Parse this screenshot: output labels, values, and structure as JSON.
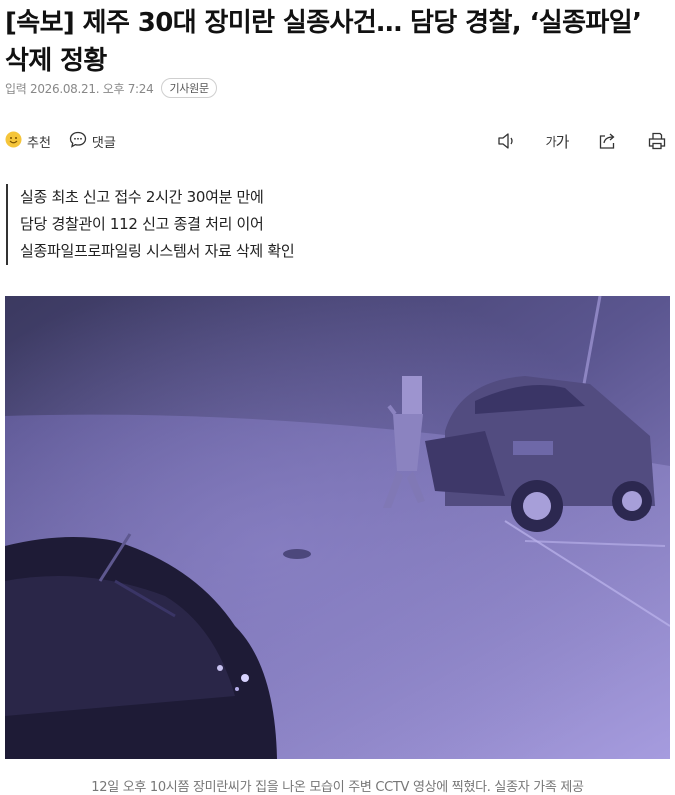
{
  "article": {
    "headline": "[속보] 제주 30대 장미란 실종사건… 담당 경찰, ‘실종파일’ 삭제 정황",
    "meta": {
      "date_text": "입력 2026.08.21. 오후 7:24",
      "original_badge": "기사원문"
    },
    "toolbar": {
      "recommend_label": "추천",
      "comment_label": "댓글",
      "font_size_small": "가",
      "font_size_large": "가",
      "icons": [
        "smile-icon",
        "comment-icon",
        "speaker-icon",
        "font-size-icon",
        "share-icon",
        "print-icon"
      ]
    },
    "summary": [
      "실종 최초 신고 접수 2시간 30여분 만에",
      "담당 경찰관이 112 신고 종결 처리 이어",
      "실종파일프로파일링 시스템서 자료 삭제 확인"
    ],
    "photo": {
      "caption": "12일 오후 10시쯤 장미란씨가 집을 나온 모습이 주변 CCTV 영상에 찍혔다. 실종자 가족 제공"
    }
  },
  "colors": {
    "text": "#222222",
    "meta_text": "#888888",
    "cctv_tint": "#8a80c8",
    "smile_icon": "#f5c53a"
  }
}
